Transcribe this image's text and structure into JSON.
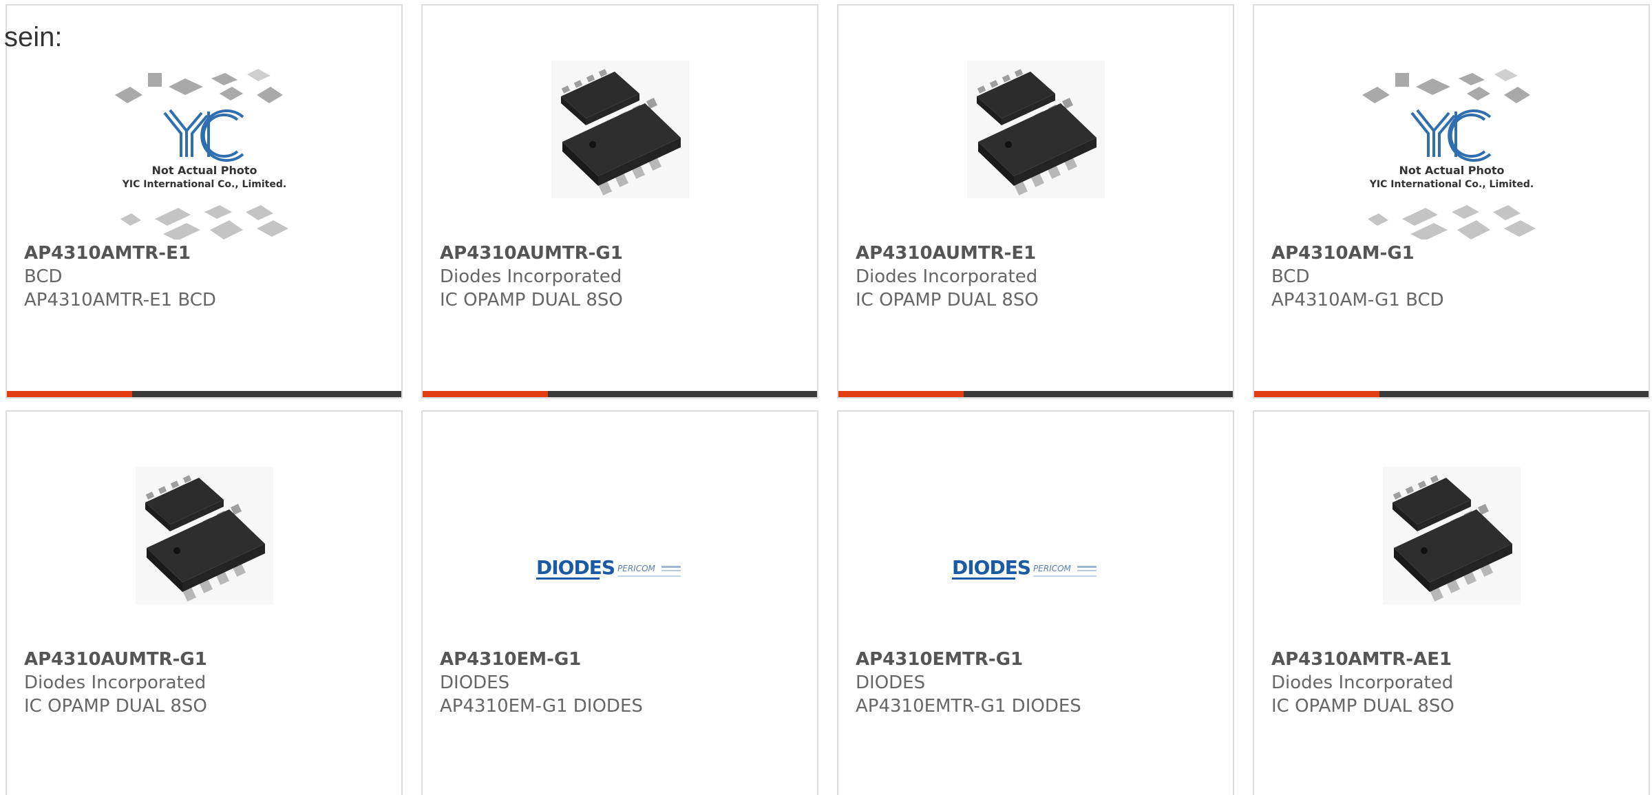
{
  "lead_text": "sein:",
  "colors": {
    "accent": "#e23d10",
    "bar": "#3a3a3a",
    "border": "#dddddd",
    "yic_blue": "#2f6fb0",
    "diodes_blue": "#1b5aa6"
  },
  "products": [
    {
      "part": "AP4310AMTR-E1",
      "manufacturer": "BCD",
      "description": "AP4310AMTR-E1 BCD",
      "image": "placeholder",
      "image_text_1": "Not Actual Photo",
      "image_text_2": "YIC International Co., Limited.",
      "image_logo": "YIC"
    },
    {
      "part": "AP4310AUMTR-G1",
      "manufacturer": "Diodes Incorporated",
      "description": "IC OPAMP DUAL 8SO",
      "image": "chip"
    },
    {
      "part": "AP4310AUMTR-E1",
      "manufacturer": "Diodes Incorporated",
      "description": "IC OPAMP DUAL 8SO",
      "image": "chip"
    },
    {
      "part": "AP4310AM-G1",
      "manufacturer": "BCD",
      "description": "AP4310AM-G1 BCD",
      "image": "placeholder",
      "image_text_1": "Not Actual Photo",
      "image_text_2": "YIC International Co., Limited.",
      "image_logo": "YIC"
    },
    {
      "part": "AP4310AUMTR-G1",
      "manufacturer": "Diodes Incorporated",
      "description": "IC OPAMP DUAL 8SO",
      "image": "chip"
    },
    {
      "part": "AP4310EM-G1",
      "manufacturer": "DIODES",
      "description": "AP4310EM-G1 DIODES",
      "image": "logo",
      "image_logo": "DIODES",
      "image_logo_2": "PERICOM"
    },
    {
      "part": "AP4310EMTR-G1",
      "manufacturer": "DIODES",
      "description": "AP4310EMTR-G1 DIODES",
      "image": "logo",
      "image_logo": "DIODES",
      "image_logo_2": "PERICOM"
    },
    {
      "part": "AP4310AMTR-AE1",
      "manufacturer": "Diodes Incorporated",
      "description": "IC OPAMP DUAL 8SO",
      "image": "chip"
    }
  ]
}
